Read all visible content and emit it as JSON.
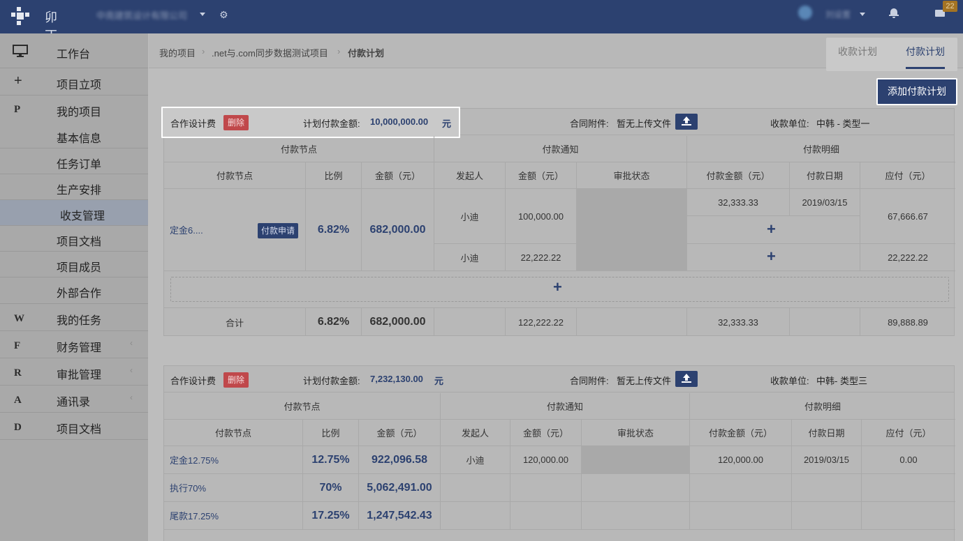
{
  "app": {
    "logo_text": "卯丁",
    "org_name": "中南建筑设计有限公司",
    "user_name": "刘设置",
    "badge_count": "22"
  },
  "sidebar": {
    "items": [
      {
        "icon": "monitor-icon",
        "label": "工作台"
      },
      {
        "icon": "plus-icon",
        "label": "项目立项"
      },
      {
        "letter": "P",
        "label": "我的项目"
      },
      {
        "label": "基本信息"
      },
      {
        "label": "任务订单"
      },
      {
        "label": "生产安排"
      },
      {
        "label": "收支管理"
      },
      {
        "label": "项目文档"
      },
      {
        "label": "项目成员"
      },
      {
        "label": "外部合作"
      },
      {
        "letter": "W",
        "label": "我的任务"
      },
      {
        "letter": "F",
        "label": "财务管理"
      },
      {
        "letter": "R",
        "label": "审批管理"
      },
      {
        "letter": "A",
        "label": "通讯录"
      },
      {
        "letter": "D",
        "label": "项目文档"
      }
    ]
  },
  "breadcrumb": {
    "items": [
      "我的项目",
      ".net与.com同步数据测试项目",
      "付款计划"
    ],
    "sep": "›"
  },
  "tabs": {
    "receive": "收款计划",
    "pay": "付款计划"
  },
  "add_button": "添加付款计划",
  "plans": [
    {
      "title": "合作设计费",
      "delete": "删除",
      "amount_label": "计划付款金额:",
      "amount": "10,000,000.00",
      "unit": "元",
      "attach_label": "合同附件:",
      "attach_value": "暂无上传文件",
      "payee_label": "收款单位:",
      "payee": "中韩 - 类型一",
      "groups": [
        "付款节点",
        "付款通知",
        "付款明细"
      ],
      "headers": [
        "付款节点",
        "比例",
        "金额（元）",
        "发起人",
        "金额（元）",
        "审批状态",
        "付款金额（元）",
        "付款日期",
        "应付（元）"
      ],
      "node_name": "定金6....",
      "apply": "付款申请",
      "ratio": "6.82%",
      "node_amount": "682,000.00",
      "notices": [
        {
          "initiator": "小迪",
          "amount": "100,000.00",
          "pay_amount": "32,333.33",
          "pay_date": "2019/03/15",
          "due": "67,666.67"
        },
        {
          "initiator": "小迪",
          "amount": "22,222.22",
          "due": "22,222.22"
        }
      ],
      "total": {
        "label": "合计",
        "ratio": "6.82%",
        "amount": "682,000.00",
        "notice_amount": "122,222.22",
        "pay_amount": "32,333.33",
        "due": "89,888.89"
      }
    },
    {
      "title": "合作设计费",
      "delete": "删除",
      "amount_label": "计划付款金额:",
      "amount": "7,232,130.00",
      "unit": "元",
      "attach_label": "合同附件:",
      "attach_value": "暂无上传文件",
      "payee_label": "收款单位:",
      "payee": "中韩- 类型三",
      "groups": [
        "付款节点",
        "付款通知",
        "付款明细"
      ],
      "headers": [
        "付款节点",
        "比例",
        "金额（元）",
        "发起人",
        "金额（元）",
        "审批状态",
        "付款金额（元）",
        "付款日期",
        "应付（元）"
      ],
      "rows": [
        {
          "name": "定金12.75%",
          "ratio": "12.75%",
          "amount": "922,096.58",
          "initiator": "小迪",
          "notice_amount": "120,000.00",
          "pay_amount": "120,000.00",
          "pay_date": "2019/03/15",
          "due": "0.00"
        },
        {
          "name": "执行70%",
          "ratio": "70%",
          "amount": "5,062,491.00"
        },
        {
          "name": "尾款17.25%",
          "ratio": "17.25%",
          "amount": "1,247,542.43"
        }
      ]
    }
  ],
  "colors": {
    "navy": "#2c4170",
    "danger": "#c0484b",
    "badge": "#a37324"
  }
}
